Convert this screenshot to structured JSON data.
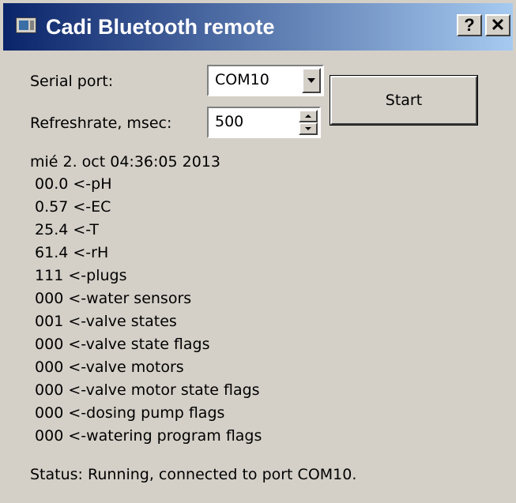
{
  "window": {
    "title": "Cadi Bluetooth remote",
    "help_label": "?",
    "close_label": "✕"
  },
  "serial_port": {
    "label": "Serial port:",
    "value": "COM10"
  },
  "refresh": {
    "label": "Refreshrate, msec:",
    "value": "500"
  },
  "start_label": "Start",
  "timestamp": "mié 2. oct 04:36:05 2013",
  "readings": [
    "00.0 <-pH",
    "0.57 <-EC",
    "25.4 <-T",
    "61.4 <-rH",
    "111 <-plugs",
    "000 <-water sensors",
    "001 <-valve states",
    "000 <-valve state flags",
    "000 <-valve motors",
    "000 <-valve motor state flags",
    "000 <-dosing pump flags",
    "000 <-watering program flags"
  ],
  "status": "Status: Running, connected to port COM10."
}
